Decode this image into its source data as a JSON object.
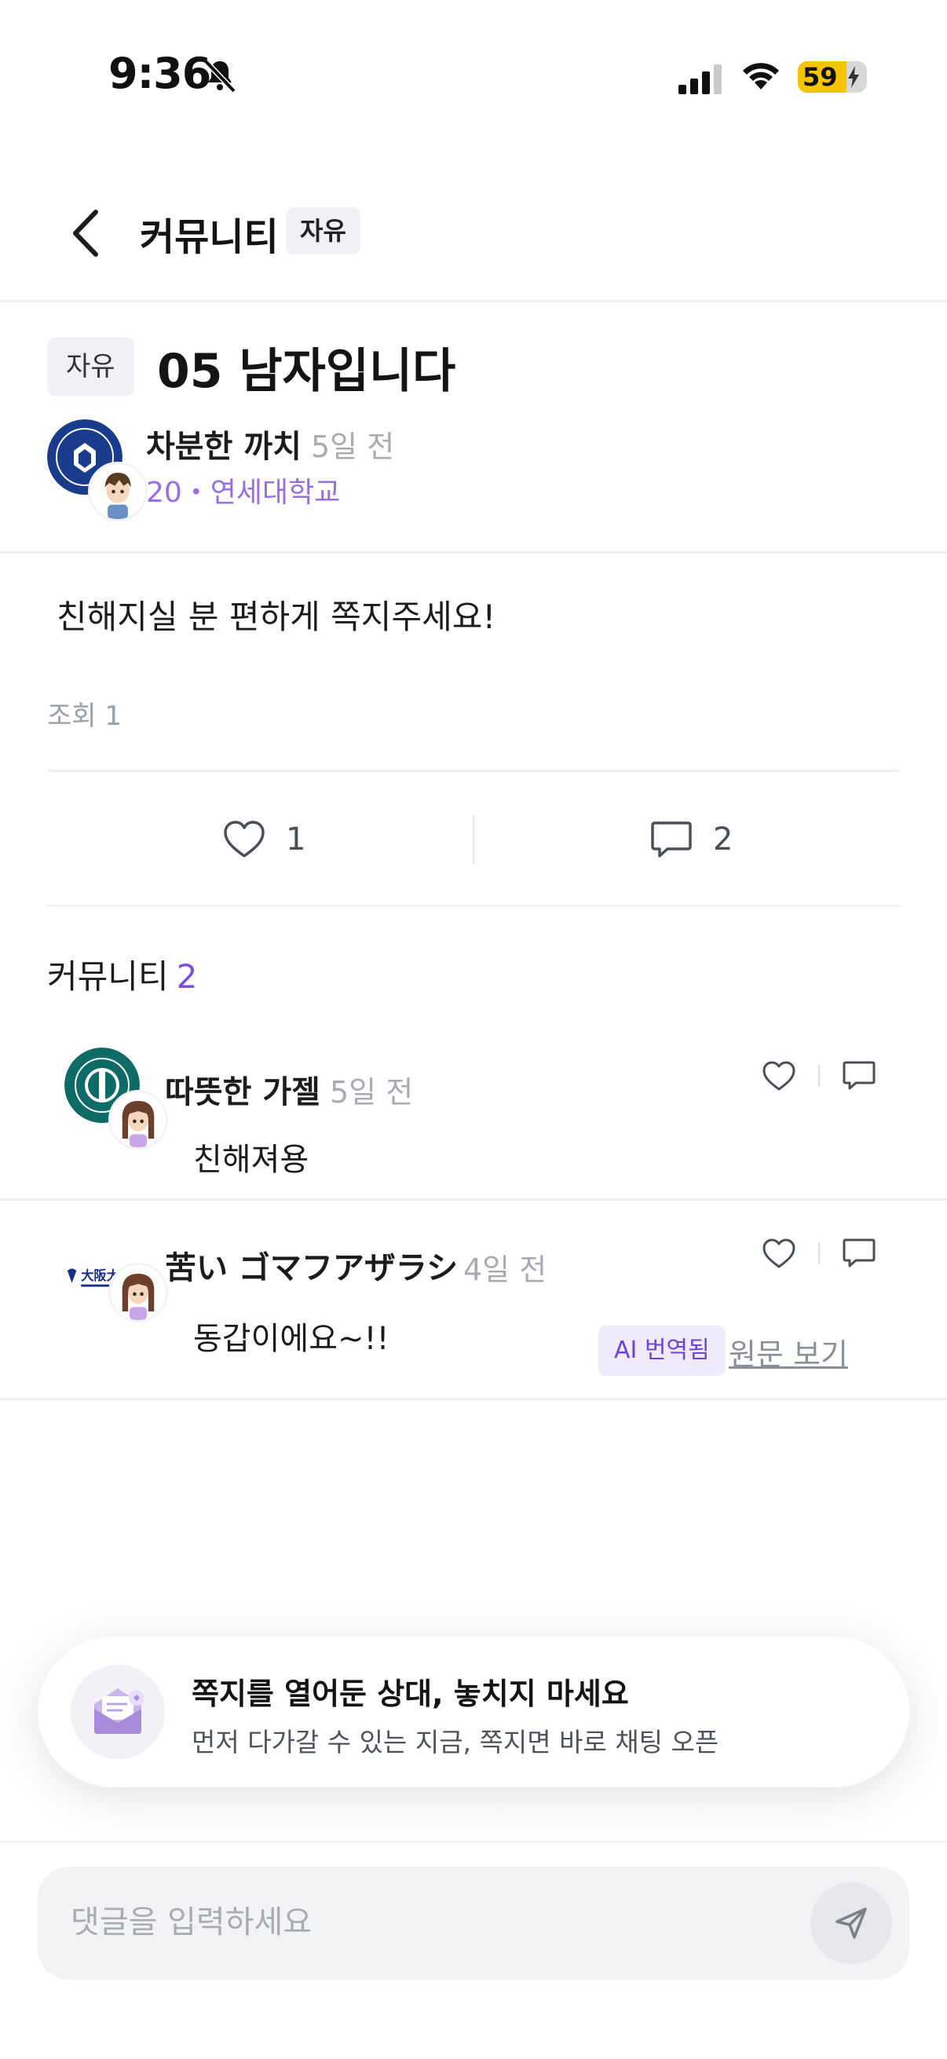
{
  "status_bar": {
    "time": "9:36",
    "battery": "59"
  },
  "header": {
    "title": "커뮤니티",
    "chip": "자유"
  },
  "post": {
    "chip": "자유",
    "title": "05 남자입니다",
    "author": {
      "name": "차분한 까치",
      "time": "5일 전",
      "meta": "20・연세대학교"
    },
    "body": "친해지실 분 편하게 쪽지주세요!",
    "views": "조회 1",
    "likes": "1",
    "comments": "2"
  },
  "comments_section": {
    "title": "커뮤니티",
    "count": "2",
    "items": [
      {
        "name": "따뜻한 가젤",
        "time": "5일 전",
        "body": "친해져용"
      },
      {
        "name": "苦い ゴマフアザラシ",
        "time": "4일 전",
        "body": "동갑이에요~!!",
        "ai_badge": "AI 번역됨",
        "view_original": "원문 보기",
        "school_logo_text": "大阪大学"
      }
    ]
  },
  "toast": {
    "title": "쪽지를 열어둔 상대, 놓치지 마세요",
    "subtitle": "먼저 다가갈 수 있는 지금, 쪽지면 바로 채팅 오픈"
  },
  "comment_input": {
    "placeholder": "댓글을 입력하세요"
  },
  "colors": {
    "accent": "#7a4fe0",
    "meta_purple": "#9a6de0",
    "battery": "#f4c400"
  }
}
